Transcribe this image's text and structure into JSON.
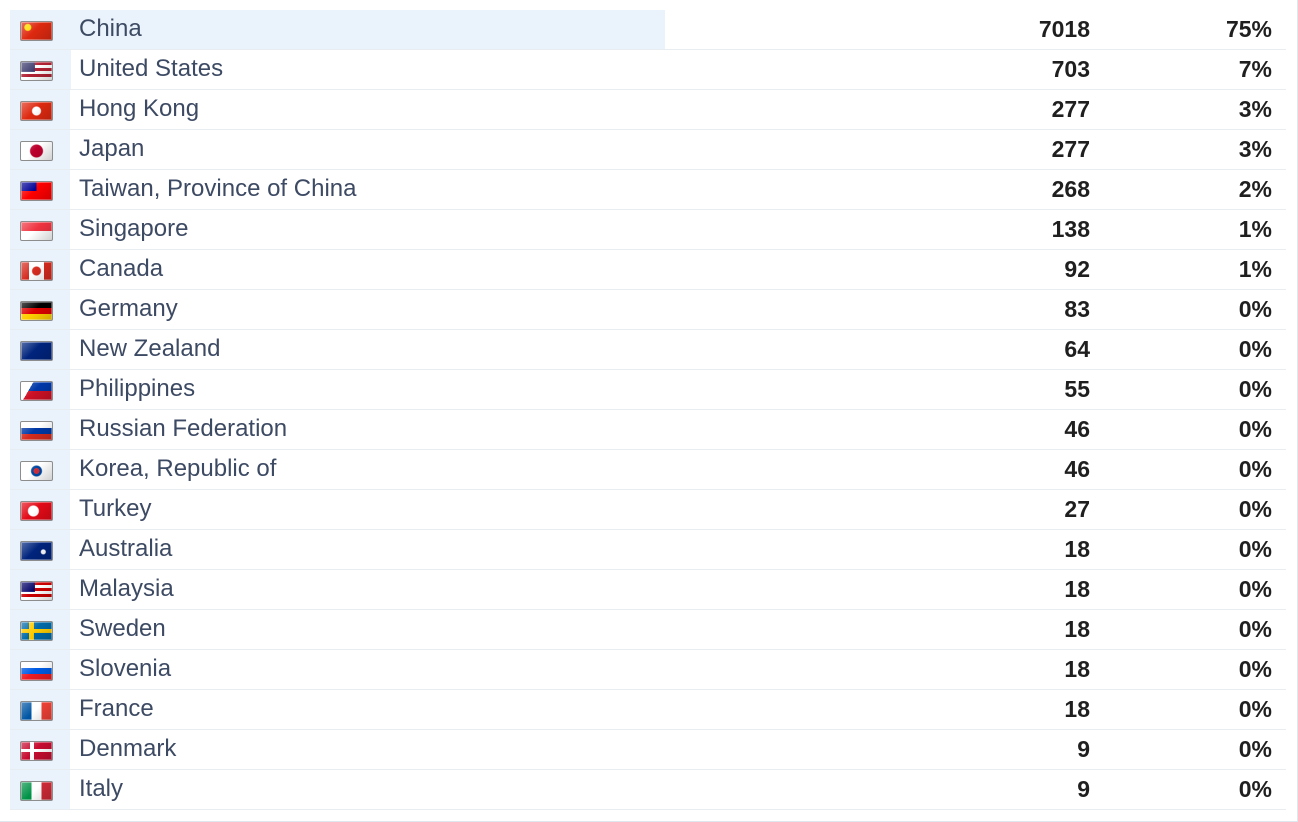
{
  "countries": [
    {
      "name": "China",
      "count": "7018",
      "percent": "75%",
      "share": 0.75,
      "flag": "china-flag",
      "flag_css": "radial-gradient(circle at 22% 30%, #ffde00 0 3px, transparent 4px), #de2910"
    },
    {
      "name": "United States",
      "count": "703",
      "percent": "7%",
      "share": 0.07,
      "flag": "united-states-flag",
      "flag_css": "linear-gradient(#3c3b6e, #3c3b6e) 0 0 / 45% 55% no-repeat, repeating-linear-gradient(#b22234 0 3px, #ffffff 3px 6px)"
    },
    {
      "name": "Hong Kong",
      "count": "277",
      "percent": "3%",
      "share": 0.03,
      "flag": "hong-kong-flag",
      "flag_css": "radial-gradient(circle at 50% 50%, #ffffff 0 4px, transparent 5px), #de2910"
    },
    {
      "name": "Japan",
      "count": "277",
      "percent": "3%",
      "share": 0.03,
      "flag": "japan-flag",
      "flag_css": "radial-gradient(circle at 50% 50%, #bc002d 0 6px, transparent 7px), #ffffff"
    },
    {
      "name": "Taiwan, Province of China",
      "count": "268",
      "percent": "2%",
      "share": 0.02,
      "flag": "taiwan-flag",
      "flag_css": "linear-gradient(#000095, #000095) 0 0 / 50% 50% no-repeat, #fe0000"
    },
    {
      "name": "Singapore",
      "count": "138",
      "percent": "1%",
      "share": 0.01,
      "flag": "singapore-flag",
      "flag_css": "linear-gradient(#ef3340 0 50%, #ffffff 50% 100%)"
    },
    {
      "name": "Canada",
      "count": "92",
      "percent": "1%",
      "share": 0.01,
      "flag": "canada-flag",
      "flag_css": "radial-gradient(circle at 50% 50%, #d52b1e 0 4px, transparent 5px), linear-gradient(90deg, #d52b1e 0 26%, #ffffff 26% 74%, #d52b1e 74% 100%)"
    },
    {
      "name": "Germany",
      "count": "83",
      "percent": "0%",
      "share": 0.0,
      "flag": "germany-flag",
      "flag_css": "linear-gradient(#000000 0 33.3%, #dd0000 33.3% 66.6%, #ffce00 66.6% 100%)"
    },
    {
      "name": "New Zealand",
      "count": "64",
      "percent": "0%",
      "share": 0.0,
      "flag": "new-zealand-flag",
      "flag_css": "linear-gradient(#00247d, #00247d) 0 0 / 100% 100%, radial-gradient(circle at 75% 45%, #cc142b 0 2px, transparent 3px)"
    },
    {
      "name": "Philippines",
      "count": "55",
      "percent": "0%",
      "share": 0.0,
      "flag": "philippines-flag",
      "flag_css": "linear-gradient(120deg, #ffffff 0 30%, transparent 30%), linear-gradient(#0038a8 0 50%, #ce1126 50% 100%)"
    },
    {
      "name": "Russian Federation",
      "count": "46",
      "percent": "0%",
      "share": 0.0,
      "flag": "russia-flag",
      "flag_css": "linear-gradient(#ffffff 0 33.3%, #0039a6 33.3% 66.6%, #d52b1e 66.6% 100%)"
    },
    {
      "name": "Korea, Republic of",
      "count": "46",
      "percent": "0%",
      "share": 0.0,
      "flag": "south-korea-flag",
      "flag_css": "radial-gradient(circle at 50% 50%, #cd2e3a 0 3px, #0047a0 3px 5px, transparent 6px), #ffffff"
    },
    {
      "name": "Turkey",
      "count": "27",
      "percent": "0%",
      "share": 0.0,
      "flag": "turkey-flag",
      "flag_css": "radial-gradient(circle at 40% 50%, #ffffff 0 5px, transparent 6px), #e30a17"
    },
    {
      "name": "Australia",
      "count": "18",
      "percent": "0%",
      "share": 0.0,
      "flag": "australia-flag",
      "flag_css": "radial-gradient(circle at 72% 55%, #ffffff 0 2px, transparent 3px), #00247d"
    },
    {
      "name": "Malaysia",
      "count": "18",
      "percent": "0%",
      "share": 0.0,
      "flag": "malaysia-flag",
      "flag_css": "linear-gradient(#010066, #010066) 0 0 / 45% 55% no-repeat, repeating-linear-gradient(#cc0001 0 3px, #ffffff 3px 6px)"
    },
    {
      "name": "Sweden",
      "count": "18",
      "percent": "0%",
      "share": 0.0,
      "flag": "sweden-flag",
      "flag_css": "linear-gradient(#fecc00, #fecc00) 30% 0 / 16% 100% no-repeat, linear-gradient(#fecc00, #fecc00) 0 50% / 100% 22% no-repeat, #006aa7"
    },
    {
      "name": "Slovenia",
      "count": "18",
      "percent": "0%",
      "share": 0.0,
      "flag": "slovenia-flag",
      "flag_css": "linear-gradient(#ffffff 0 33.3%, #005ce5 33.3% 66.6%, #ed1c24 66.6% 100%)"
    },
    {
      "name": "France",
      "count": "18",
      "percent": "0%",
      "share": 0.0,
      "flag": "france-flag",
      "flag_css": "linear-gradient(90deg, #0055a4 0 33.3%, #ffffff 33.3% 66.6%, #ef4135 66.6% 100%)"
    },
    {
      "name": "Denmark",
      "count": "9",
      "percent": "0%",
      "share": 0.0,
      "flag": "denmark-flag",
      "flag_css": "linear-gradient(#ffffff, #ffffff) 32% 0 / 13% 100% no-repeat, linear-gradient(#ffffff, #ffffff) 0 50% / 100% 18% no-repeat, #c60c30"
    },
    {
      "name": "Italy",
      "count": "9",
      "percent": "0%",
      "share": 0.0,
      "flag": "italy-flag",
      "flag_css": "linear-gradient(90deg, #009246 0 33.3%, #ffffff 33.3% 66.6%, #ce2b37 66.6% 100%)"
    }
  ]
}
